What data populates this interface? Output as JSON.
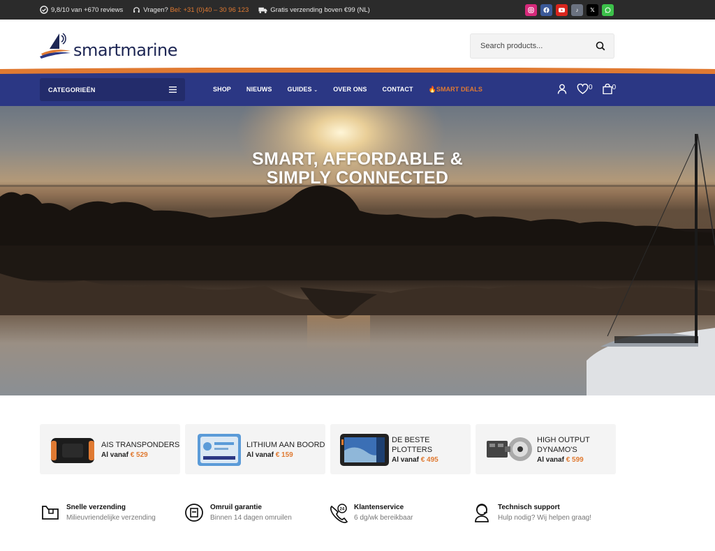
{
  "topbar": {
    "reviews": "9,8/10 van +670 reviews",
    "questions_label": "Vragen?",
    "phone": "Bel: +31 (0)40 – 30 96 123",
    "shipping": "Gratis verzending boven €99 (NL)",
    "social": [
      "instagram-icon",
      "facebook-icon",
      "youtube-icon",
      "tiktok-icon",
      "x-icon",
      "whatsapp-icon"
    ]
  },
  "header": {
    "logo_text": "smartmarine",
    "search_placeholder": "Search products..."
  },
  "nav": {
    "categories_label": "CATEGORIEËN",
    "items": [
      "SHOP",
      "NIEUWS",
      "GUIDES",
      "OVER ONS",
      "CONTACT",
      "SMART DEALS"
    ],
    "wishlist_count": "0",
    "cart_count": "0"
  },
  "hero": {
    "title_line1": "SMART, AFFORDABLE &",
    "title_line2": "SIMPLY CONNECTED"
  },
  "cards": [
    {
      "title": "AIS TRANSPONDERS",
      "price_prefix": "Al vanaf",
      "price": "€ 529"
    },
    {
      "title": "LITHIUM AAN BOORD",
      "price_prefix": "Al vanaf",
      "price": "€ 159"
    },
    {
      "title": "DE BESTE PLOTTERS",
      "price_prefix": "Al vanaf",
      "price": "€ 495"
    },
    {
      "title": "HIGH OUTPUT DYNAMO'S",
      "price_prefix": "Al vanaf",
      "price": "€ 599"
    }
  ],
  "usps": [
    {
      "title": "Snelle verzending",
      "subtitle": "Milieuvriendelijke verzending"
    },
    {
      "title": "Omruil garantie",
      "subtitle": "Binnen 14 dagen omruilen"
    },
    {
      "title": "Klantenservice",
      "subtitle": "6 dg/wk bereikbaar"
    },
    {
      "title": "Technisch support",
      "subtitle": "Hulp nodig? Wij helpen graag!"
    }
  ],
  "colors": {
    "accent": "#e07a32",
    "navy": "#2b3784",
    "topbar": "#2b2b2b"
  }
}
